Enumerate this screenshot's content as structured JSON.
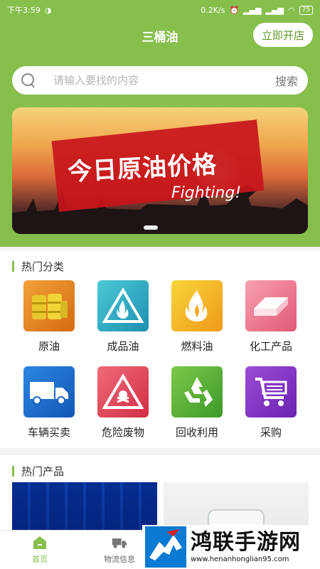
{
  "status": {
    "time": "下午3:59",
    "speed": "0.2K/s",
    "battery": "75"
  },
  "header": {
    "title": "三桶油",
    "open_shop": "立即开店"
  },
  "search": {
    "placeholder": "请输入要找的内容",
    "button": "搜索"
  },
  "banner": {
    "title": "今日原油价格",
    "subtitle": "Fighting!"
  },
  "categories": {
    "title": "热门分类",
    "items": [
      {
        "label": "原油",
        "icon": "oil-barrels-icon"
      },
      {
        "label": "成品油",
        "icon": "fire-hazard-icon"
      },
      {
        "label": "燃料油",
        "icon": "flame-icon"
      },
      {
        "label": "化工产品",
        "icon": "chemical-block-icon"
      },
      {
        "label": "车辆买卖",
        "icon": "truck-icon"
      },
      {
        "label": "危险废物",
        "icon": "toxic-hazard-icon"
      },
      {
        "label": "回收利用",
        "icon": "recycle-icon"
      },
      {
        "label": "采购",
        "icon": "shopping-cart-icon"
      }
    ]
  },
  "products": {
    "title": "热门产品"
  },
  "nav": {
    "home": "首页",
    "logistics": "物流信息"
  },
  "watermark": {
    "title": "鸿联手游网",
    "url": "www.henanhonglian95.com"
  },
  "colors": {
    "accent": "#86bf4c"
  }
}
